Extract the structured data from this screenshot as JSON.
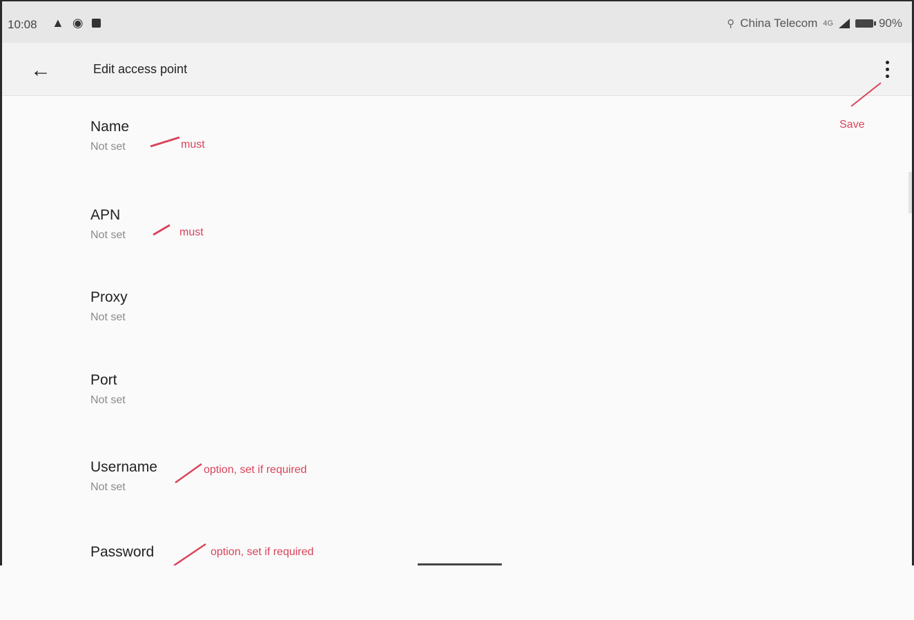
{
  "status_bar": {
    "time": "10:08",
    "left_icons": [
      "warning-icon",
      "record-icon",
      "image-icon"
    ],
    "carrier": "China Telecom",
    "network": "4G",
    "battery": "90%"
  },
  "app_bar": {
    "title": "Edit access point"
  },
  "preferences": [
    {
      "title": "Name",
      "summary": "Not set"
    },
    {
      "title": "APN",
      "summary": "Not set"
    },
    {
      "title": "Proxy",
      "summary": "Not set"
    },
    {
      "title": "Port",
      "summary": "Not set"
    },
    {
      "title": "Username",
      "summary": "Not set"
    },
    {
      "title": "Password",
      "summary": ""
    }
  ],
  "annotations": {
    "save": "Save",
    "name_note": "must",
    "apn_note": "must",
    "username_note": "option, set if required",
    "password_note": "option, set if required",
    "color": "#d9435a"
  }
}
